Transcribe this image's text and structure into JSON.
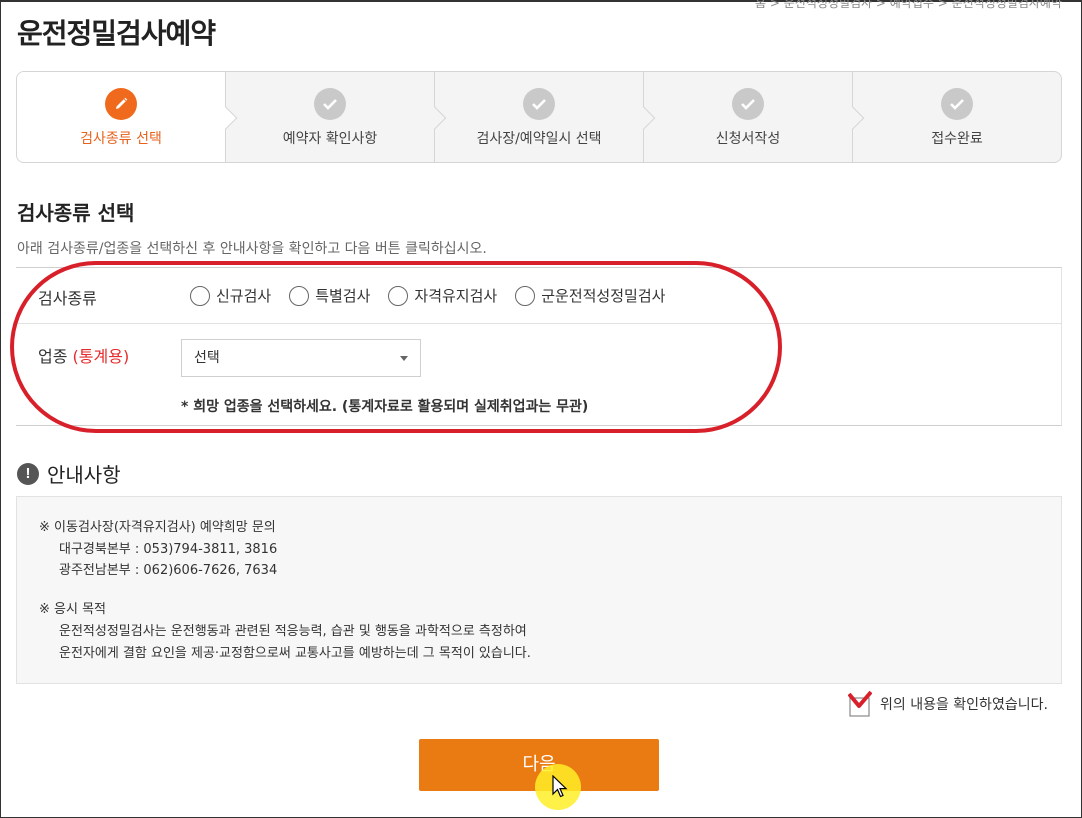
{
  "breadcrumb": "홈 > 운전적성정밀검사 > 예약접수 > 운전적성정밀검사예약",
  "page": {
    "title": "운전정밀검사예약"
  },
  "stepper": {
    "steps": [
      {
        "label": "검사종류 선택",
        "icon": "pencil-icon",
        "active": true
      },
      {
        "label": "예약자 확인사항",
        "icon": "check-icon",
        "active": false
      },
      {
        "label": "검사장/예약일시 선택",
        "icon": "check-icon",
        "active": false
      },
      {
        "label": "신청서작성",
        "icon": "check-icon",
        "active": false
      },
      {
        "label": "접수완료",
        "icon": "check-icon",
        "active": false
      }
    ]
  },
  "section": {
    "title": "검사종류 선택",
    "description": "아래 검사종류/업종을 선택하신 후 안내사항을 확인하고 다음 버튼 클릭하십시오."
  },
  "form": {
    "exam_type_label": "검사종류",
    "exam_types": [
      "신규검사",
      "특별검사",
      "자격유지검사",
      "군운전적성정밀검사"
    ],
    "industry_label": "업종",
    "industry_label_note": "(통계용)",
    "industry_select_value": "선택",
    "industry_hint": "* 희망 업종을 선택하세요. (통계자료로 활용되며 실제취업과는 무관)"
  },
  "notice": {
    "title": "안내사항",
    "lines": [
      "※ 이동검사장(자격유지검사) 예약희망 문의",
      "대구경북본부 : 053)794-3811, 3816",
      "광주전남본부 : 062)606-7626, 7634",
      "※ 응시 목적",
      "운전적성정밀검사는 운전행동과 관련된 적응능력, 습관 및 행동을 과학적으로 측정하여",
      "운전자에게 결함 요인을 제공·교정함으로써 교통사고를 예방하는데 그 목적이 있습니다."
    ]
  },
  "confirm": {
    "label": "위의 내용을 확인하였습니다.",
    "checked": true
  },
  "next_button": {
    "label": "다음"
  },
  "colors": {
    "accent_orange": "#ea7a12",
    "active_step": "#f06a1d",
    "highlight_red": "#d8202a",
    "required_red": "#e52b2b"
  }
}
